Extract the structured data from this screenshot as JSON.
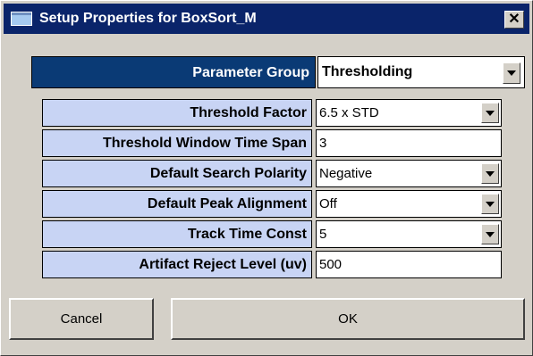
{
  "window": {
    "title": "Setup Properties for BoxSort_M",
    "close_glyph": "✕"
  },
  "parameter_group": {
    "label": "Parameter Group",
    "value": "Thresholding"
  },
  "parameters": [
    {
      "label": "Threshold Factor",
      "value": "6.5 x STD",
      "kind": "dropdown"
    },
    {
      "label": "Threshold Window Time Span",
      "value": "3",
      "kind": "text"
    },
    {
      "label": "Default Search Polarity",
      "value": "Negative",
      "kind": "dropdown"
    },
    {
      "label": "Default Peak Alignment",
      "value": "Off",
      "kind": "dropdown"
    },
    {
      "label": "Track Time Const",
      "value": "5",
      "kind": "dropdown"
    },
    {
      "label": "Artifact Reject Level (uv)",
      "value": "500",
      "kind": "text"
    }
  ],
  "buttons": {
    "cancel": "Cancel",
    "ok": "OK"
  },
  "colors": {
    "title_bar": "#0a246a",
    "group_label_bg": "#0a3a75",
    "param_label_bg": "#c8d4f4",
    "dialog_bg": "#d4d0c8"
  }
}
